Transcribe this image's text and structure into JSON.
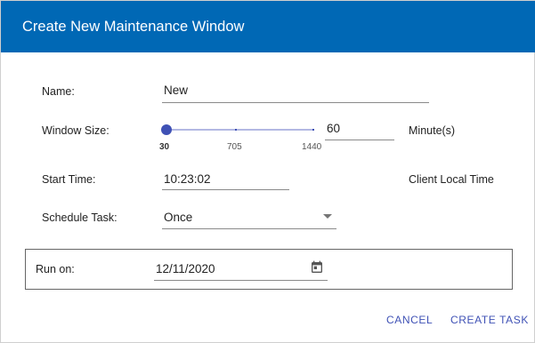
{
  "dialog": {
    "title": "Create New Maintenance Window"
  },
  "form": {
    "name": {
      "label": "Name:",
      "value": "New"
    },
    "window_size": {
      "label": "Window Size:",
      "value": "60",
      "unit": "Minute(s)",
      "slider": {
        "min_label": "30",
        "mid_label": "705",
        "max_label": "1440",
        "min": 30,
        "max": 1440,
        "current": 30
      }
    },
    "start_time": {
      "label": "Start Time:",
      "value": "10:23:02",
      "note": "Client Local Time"
    },
    "schedule_task": {
      "label": "Schedule Task:",
      "value": "Once"
    },
    "run_on": {
      "label": "Run on:",
      "value": "12/11/2020"
    }
  },
  "actions": {
    "cancel": "CANCEL",
    "create": "CREATE TASK"
  },
  "colors": {
    "title_bar": "#0068b5",
    "accent": "#3f51b5"
  },
  "icons": {
    "dropdown": "arrow-drop-down-icon",
    "calendar": "calendar-icon"
  }
}
